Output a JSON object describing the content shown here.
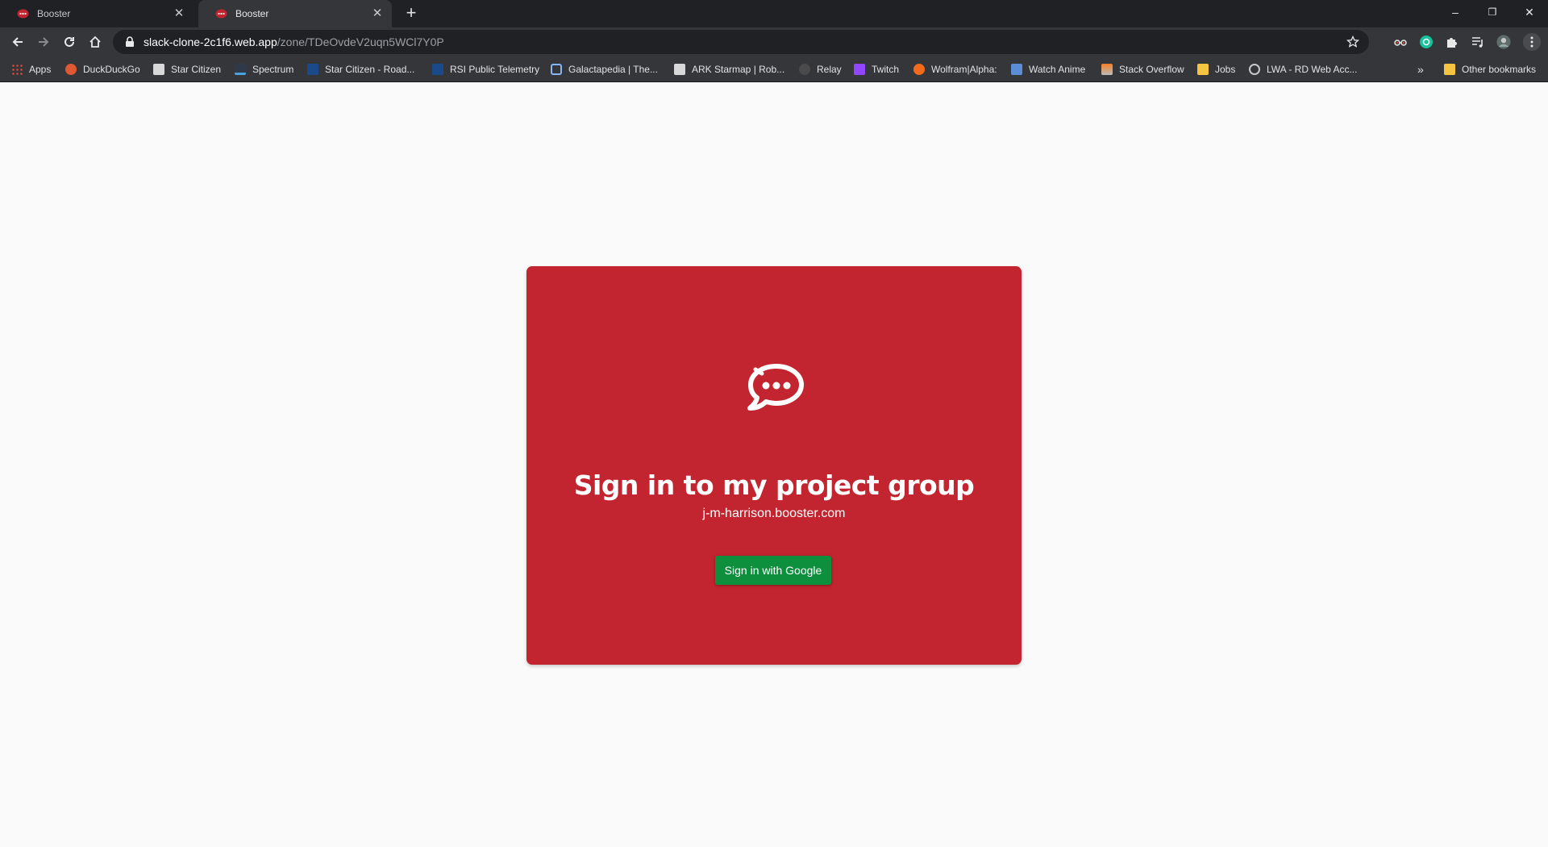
{
  "browser": {
    "tabs": [
      {
        "title": "Booster",
        "active": false
      },
      {
        "title": "Booster",
        "active": true
      }
    ],
    "new_tab_label": "+",
    "window_controls": {
      "minimize": "–",
      "restore": "❐",
      "close": "✕"
    },
    "url": {
      "host": "slack-clone-2c1f6.web.app",
      "path": "/zone/TDeOvdeV2uqn5WCl7Y0P"
    },
    "bookmarks": [
      {
        "label": "Apps",
        "icon": "apps-grid-icon",
        "color": "#e04b3a"
      },
      {
        "label": "DuckDuckGo",
        "icon": "duckduckgo-icon",
        "color": "#de5833"
      },
      {
        "label": "Star Citizen",
        "icon": "cloud-imperium-icon",
        "color": "#e0e0e0"
      },
      {
        "label": "Spectrum",
        "icon": "spectrum-icon",
        "color": "#4aa3df"
      },
      {
        "label": "Star Citizen - Road...",
        "icon": "rsi-icon",
        "color": "#1a4a8a"
      },
      {
        "label": "RSI Public Telemetry",
        "icon": "rsi-icon",
        "color": "#1a4a8a"
      },
      {
        "label": "Galactapedia | The...",
        "icon": "galactapedia-icon",
        "color": "#8ab4f8"
      },
      {
        "label": "ARK Starmap | Rob...",
        "icon": "cloud-imperium-icon",
        "color": "#e0e0e0"
      },
      {
        "label": "Relay",
        "icon": "relay-icon",
        "color": "#555555"
      },
      {
        "label": "Twitch",
        "icon": "twitch-icon",
        "color": "#9146ff"
      },
      {
        "label": "Wolfram|Alpha:",
        "icon": "wolfram-icon",
        "color": "#f26a1b"
      },
      {
        "label": "Watch Anime",
        "icon": "anime-icon",
        "color": "#5b8cd6"
      },
      {
        "label": "Stack Overflow",
        "icon": "stackoverflow-icon",
        "color": "#f48024"
      },
      {
        "label": "Jobs",
        "icon": "folder-icon",
        "color": "#f5c542"
      },
      {
        "label": "LWA - RD Web Acc...",
        "icon": "globe-icon",
        "color": "#c8c8c8"
      }
    ],
    "overflow_label": "»",
    "other_bookmarks": "Other bookmarks"
  },
  "signin": {
    "heading": "Sign in to my project group",
    "subdomain": "j-m-harrison.booster.com",
    "google_button": "Sign in with Google",
    "logo_icon": "chat-bubble-logo-icon"
  },
  "colors": {
    "card": "#c2252f",
    "google_button": "#0d8f3e",
    "page_bg": "#fbfafb"
  }
}
